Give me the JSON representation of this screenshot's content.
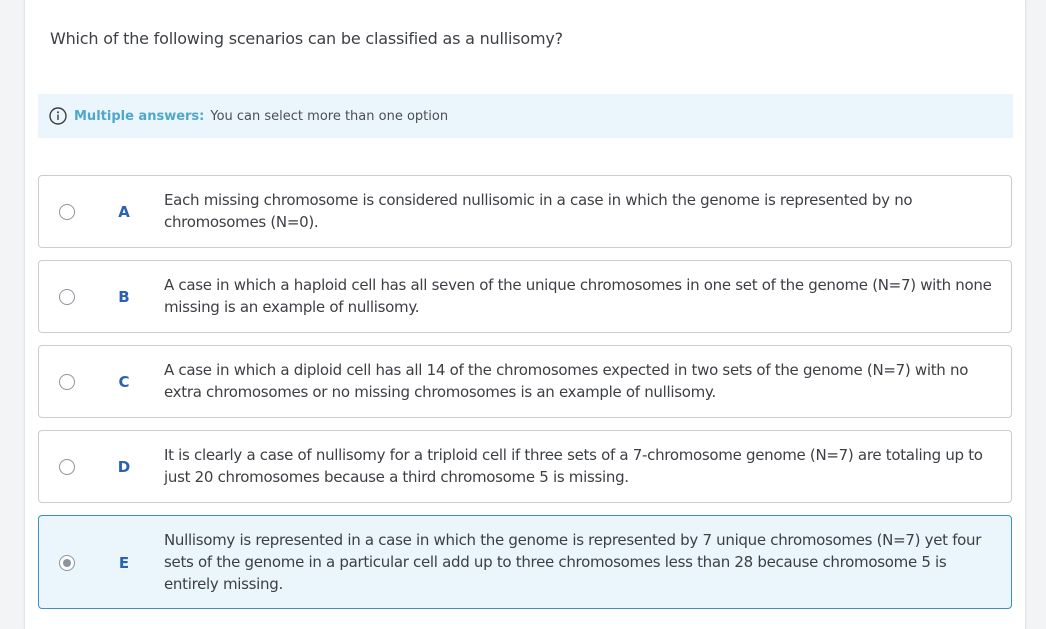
{
  "question": {
    "text": "Which of the following scenarios can be classified as a nullisomy?"
  },
  "info": {
    "icon": "info-icon",
    "label": "Multiple answers:",
    "text": "You can select more than one option"
  },
  "options": [
    {
      "letter": "A",
      "text": "Each missing chromosome is considered nullisomic in a case in which the genome is represented by no chromosomes (N=0).",
      "selected": false
    },
    {
      "letter": "B",
      "text": "A case in which a haploid cell has all seven of the unique chromosomes in one set of the genome (N=7) with none missing is an example of nullisomy.",
      "selected": false
    },
    {
      "letter": "C",
      "text": "A case in which a diploid cell has all 14 of the chromosomes expected in two sets of the genome (N=7) with no extra chromosomes or no missing chromosomes is an example of nullisomy.",
      "selected": false
    },
    {
      "letter": "D",
      "text": "It is clearly a case of nullisomy for a triploid cell if three sets of a 7-chromosome genome (N=7) are totaling up to just 20 chromosomes because a third chromosome 5 is missing.",
      "selected": false
    },
    {
      "letter": "E",
      "text": "Nullisomy is represented in a case in which the genome is represented by 7 unique chromosomes (N=7) yet four sets of the genome in a particular cell add up to three chromosomes less than 28 because chromosome 5 is entirely missing.",
      "selected": true
    }
  ],
  "colors": {
    "accent": "#2a62b3",
    "info_label": "#4fa8c8",
    "selected_bg": "#eaf6fc",
    "selected_border": "#3d8fc4"
  }
}
